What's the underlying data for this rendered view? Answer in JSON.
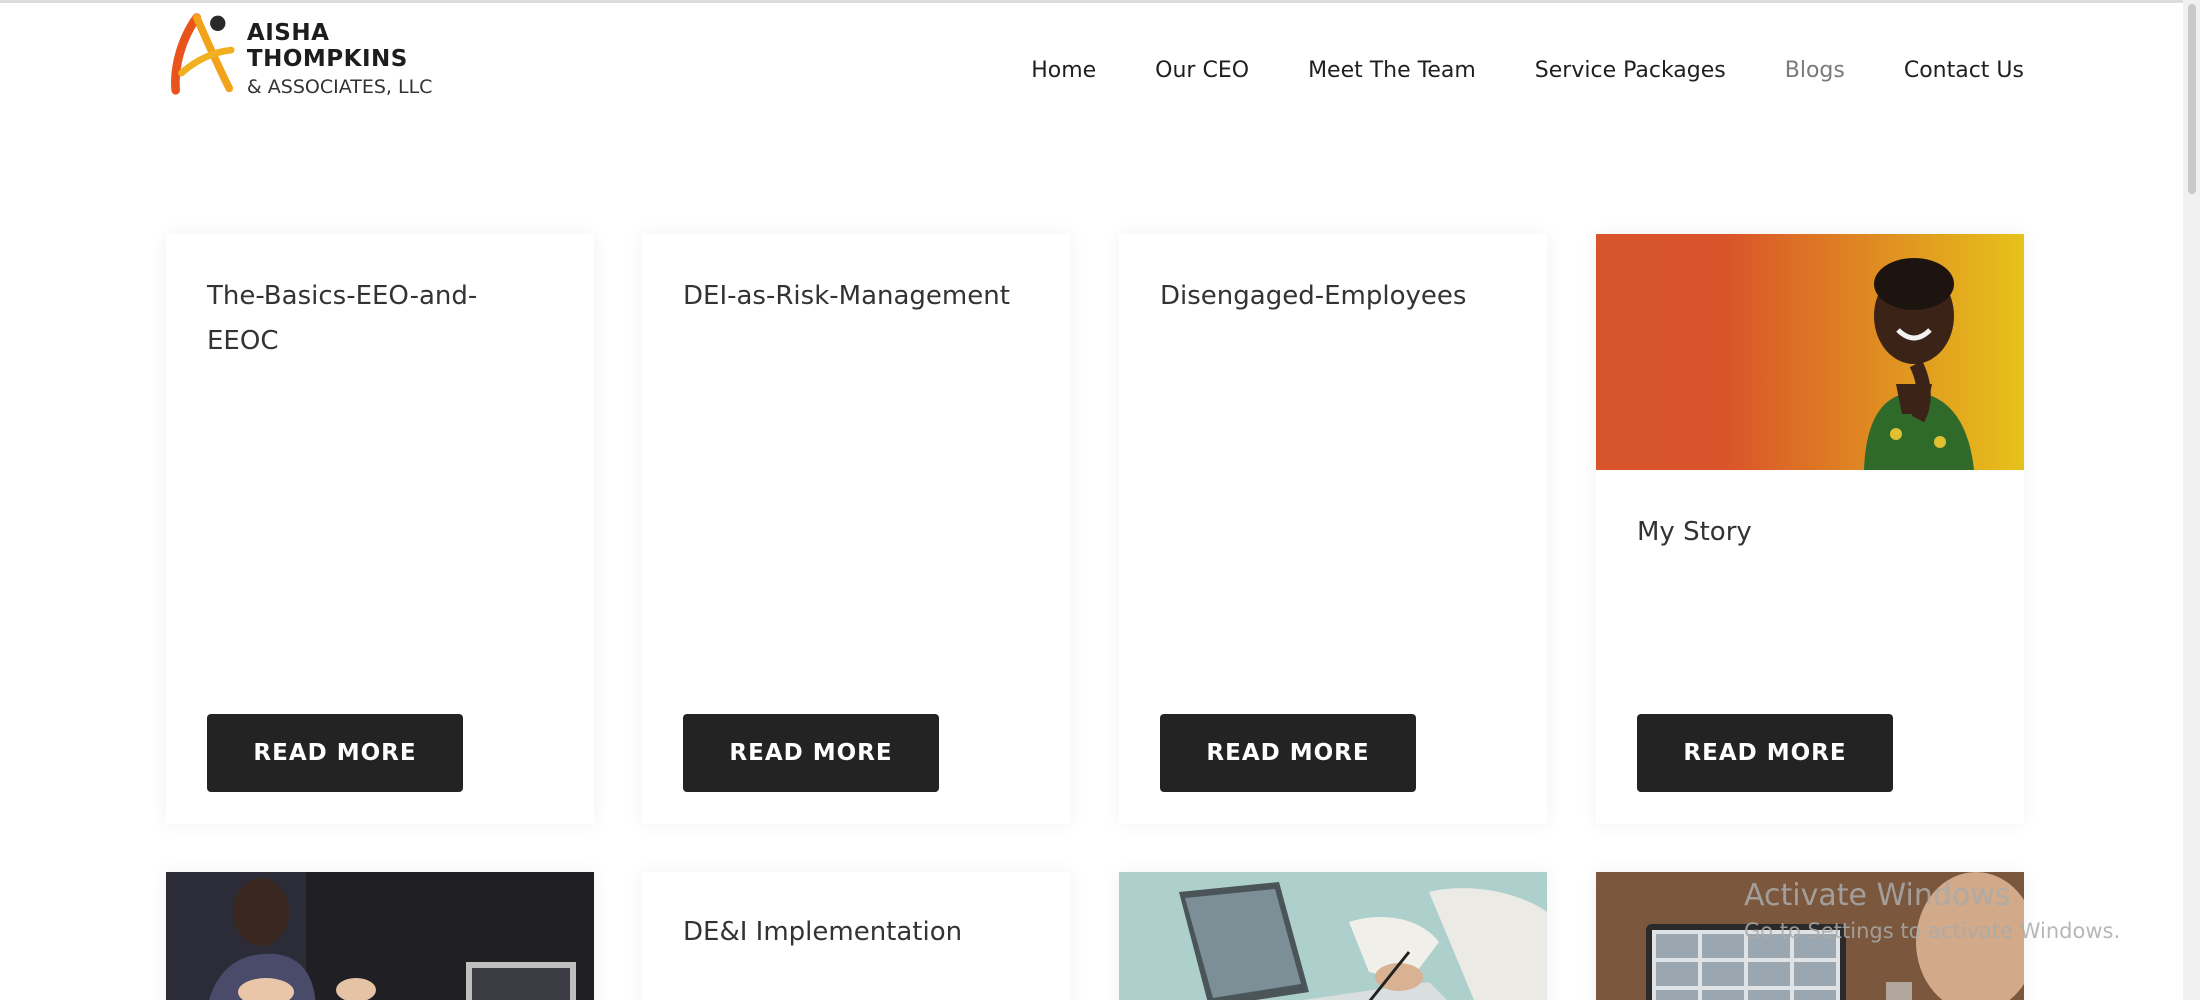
{
  "header": {
    "logo_line1": "AISHA THOMPKINS",
    "logo_line2": "& ASSOCIATES, LLC",
    "nav": [
      {
        "label": "Home",
        "active": false
      },
      {
        "label": "Our CEO",
        "active": false
      },
      {
        "label": "Meet The Team",
        "active": false
      },
      {
        "label": "Service Packages",
        "active": false
      },
      {
        "label": "Blogs",
        "active": true
      },
      {
        "label": "Contact Us",
        "active": false
      }
    ]
  },
  "posts": [
    {
      "title": "The-Basics-EEO-and-EEOC",
      "button": "READ MORE"
    },
    {
      "title": "DEI-as-Risk-Management",
      "button": "READ MORE"
    },
    {
      "title": "Disengaged-Employees",
      "button": "READ MORE"
    },
    {
      "title": "My Story",
      "button": "READ MORE",
      "image": "portrait-photo"
    },
    {
      "image": "meeting-photo"
    },
    {
      "title": "DE&I Implementation"
    },
    {
      "image": "laptop-writing-photo"
    },
    {
      "image": "video-call-photo"
    }
  ],
  "watermark": {
    "line1": "Activate Windows",
    "line2": "Go to Settings to activate Windows."
  },
  "colors": {
    "button_bg": "#232323",
    "nav_active": "#7a7a7a",
    "gradient_left": "#d9542a",
    "gradient_right": "#e6c21a"
  }
}
